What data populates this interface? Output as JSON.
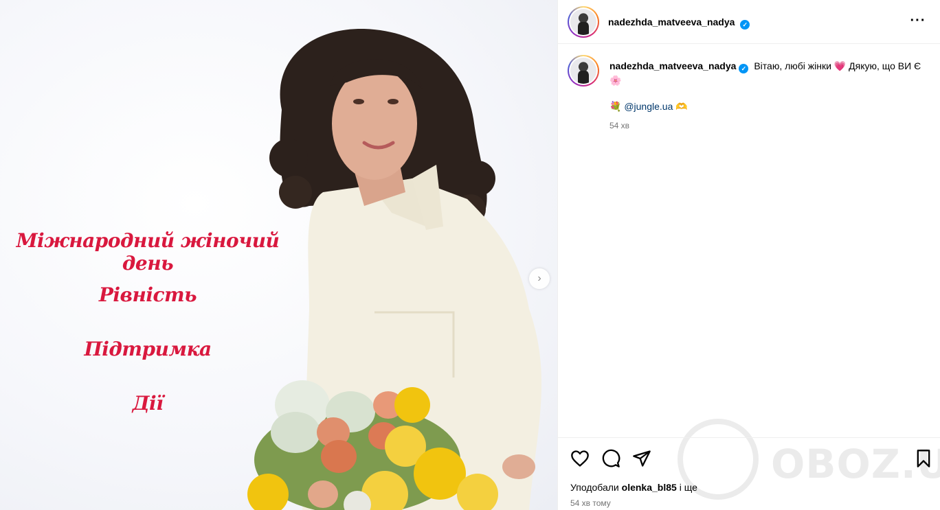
{
  "media": {
    "overlay_lines": [
      "Міжнародний жіночий день",
      "Рівність",
      "Підтримка",
      "Дії"
    ],
    "next_label": "›"
  },
  "header": {
    "username": "nadezhda_matveeva_nadya",
    "verified_mark": "✓",
    "more_label": "···"
  },
  "caption": {
    "username": "nadezhda_matveeva_nadya",
    "text": "Вітаю, любі жінки 💗 Дякую, що ВИ Є 🌸",
    "line2_emoji": "💐",
    "mention": "@jungle.ua",
    "line2_emoji_end": "🫶",
    "time": "54 хв"
  },
  "actions": {
    "liked_by_prefix": "Уподобали",
    "liked_by_user": "olenka_bl85",
    "liked_by_suffix": "і ще",
    "post_time": "54 хв тому"
  },
  "watermark": {
    "text": "OBOZ.UA"
  },
  "icons": [
    "chevron-right-icon",
    "verified-icon",
    "more-icon",
    "heart-icon",
    "comment-icon",
    "share-icon",
    "bookmark-icon"
  ],
  "colors": {
    "overlay_text": "#d9183e",
    "verified": "#0095f6",
    "mention": "#00376b",
    "muted": "#737373"
  }
}
